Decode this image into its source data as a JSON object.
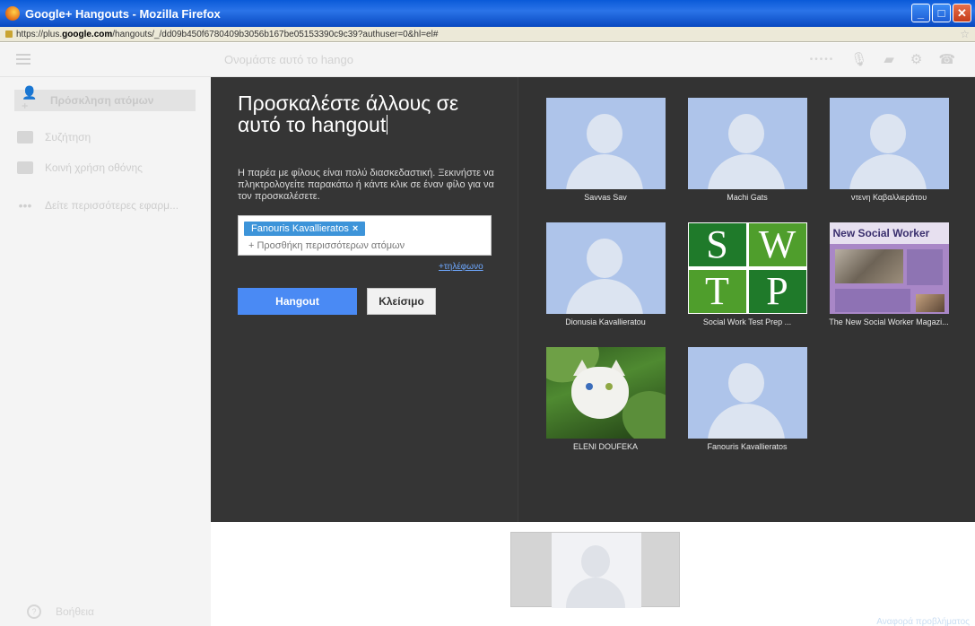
{
  "window": {
    "title": "Google+ Hangouts - Mozilla Firefox",
    "url_prefix": "https://plus.",
    "url_domain": "google.com",
    "url_suffix": "/hangouts/_/dd09b450f6780409b3056b167be05153390c9c39?authuser=0&hl=el#"
  },
  "header": {
    "hangout_name_placeholder": "Ονομάστε αυτό το hango"
  },
  "sidebar": {
    "items": [
      {
        "label": "Πρόσκληση ατόμων",
        "icon": "add-person-icon"
      },
      {
        "label": "Συζήτηση",
        "icon": "chat-icon"
      },
      {
        "label": "Κοινή χρήση οθόνης",
        "icon": "screen-share-icon"
      },
      {
        "label": "Δείτε περισσότερες εφαρμ...",
        "icon": "more-dots-icon"
      }
    ],
    "help_label": "Βοήθεια"
  },
  "invite": {
    "title": "Προσκαλέστε άλλους σε αυτό το hangout",
    "description": "Η παρέα με φίλους είναι πολύ διασκεδαστική. Ξεκινήστε να πληκτρολογείτε παρακάτω ή κάντε κλικ σε έναν φίλο για να τον προσκαλέσετε.",
    "chip": "Fanouris Kavallieratos",
    "add_more": "+ Προσθήκη περισσότερων ατόμων",
    "phone_link": "+τηλέφωνο",
    "hangout_button": "Hangout",
    "close_button": "Κλείσιμο"
  },
  "contacts": [
    {
      "name": "Savvas Sav",
      "photo": "default-avatar"
    },
    {
      "name": "Machi Gats",
      "photo": "default-avatar"
    },
    {
      "name": "ντενη Καβαλλιεράτου",
      "photo": "default-avatar"
    },
    {
      "name": "Dionusia Kavallieratou",
      "photo": "default-avatar"
    },
    {
      "name": "Social Work Test Prep ...",
      "photo": "swtp-logo"
    },
    {
      "name": "The New Social Worker Magazi...",
      "photo": "magazine-cover"
    },
    {
      "name": "ELENI DOUFEKA",
      "photo": "cat-photo"
    },
    {
      "name": "Fanouris Kavallieratos",
      "photo": "default-avatar"
    }
  ],
  "swtp_letters": [
    "S",
    "W",
    "T",
    "P"
  ],
  "nsw_masthead": "New Social Worker",
  "footer": {
    "report": "Αναφορά προβλήματος"
  },
  "colors": {
    "dialog_bg": "#333333",
    "primary_button": "#4a8af4",
    "chip": "#3d94d9"
  }
}
